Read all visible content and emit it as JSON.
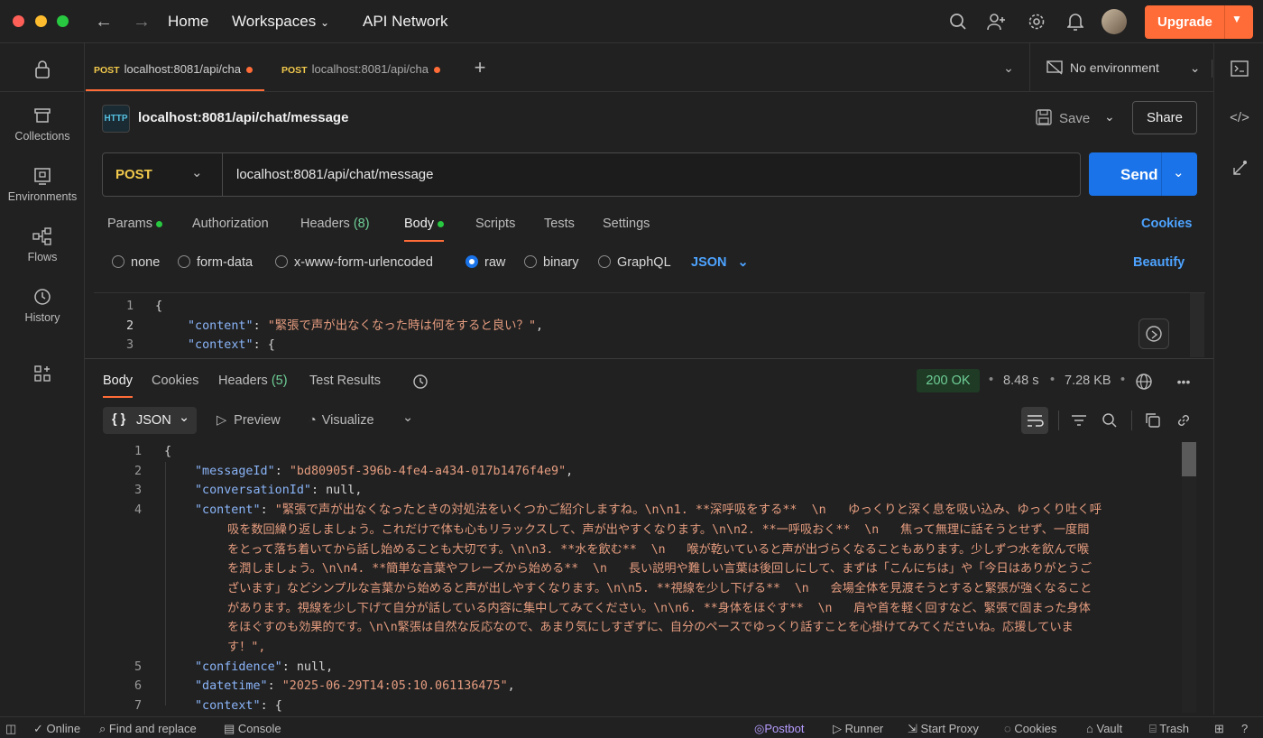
{
  "nav": {
    "home": "Home",
    "workspaces": "Workspaces",
    "api_network": "API Network",
    "upgrade": "Upgrade"
  },
  "sidebar": {
    "items": [
      {
        "label": "Collections",
        "icon": "trash-can-icon"
      },
      {
        "label": "Environments",
        "icon": "environment-icon"
      },
      {
        "label": "Flows",
        "icon": "flows-icon"
      },
      {
        "label": "History",
        "icon": "history-icon"
      }
    ]
  },
  "tabs": [
    {
      "method": "POST",
      "label": "localhost:8081/api/cha"
    },
    {
      "method": "POST",
      "label": "localhost:8081/api/cha"
    }
  ],
  "environment": "No environment",
  "request": {
    "title": "localhost:8081/api/chat/message",
    "save": "Save",
    "share": "Share",
    "method": "POST",
    "url": "localhost:8081/api/chat/message",
    "send": "Send",
    "tabs": {
      "params": "Params",
      "authorization": "Authorization",
      "headers": "Headers",
      "headers_count": "(8)",
      "body": "Body",
      "scripts": "Scripts",
      "tests": "Tests",
      "settings": "Settings"
    },
    "cookies": "Cookies",
    "body_types": {
      "none": "none",
      "form_data": "form-data",
      "urlencoded": "x-www-form-urlencoded",
      "raw": "raw",
      "binary": "binary",
      "graphql": "GraphQL"
    },
    "format": "JSON",
    "beautify": "Beautify",
    "code_lines": [
      {
        "n": "1",
        "text": "{"
      },
      {
        "n": "2",
        "key": "\"content\"",
        "val": "\"緊張で声が出なくなった時は何をすると良い？\"",
        "tail": ","
      },
      {
        "n": "3",
        "key": "\"context\"",
        "val": "{",
        "tail": ""
      }
    ]
  },
  "response": {
    "tabs": {
      "body": "Body",
      "cookies": "Cookies",
      "headers": "Headers",
      "headers_count": "(5)",
      "test_results": "Test Results"
    },
    "status": "200 OK",
    "time": "8.48 s",
    "size": "7.28 KB",
    "format": "JSON",
    "preview": "Preview",
    "visualize": "Visualize",
    "lines": {
      "l1": "{",
      "l2k": "\"messageId\"",
      "l2v": "\"bd80905f-396b-4fe4-a434-017b1476f4e9\"",
      "l3k": "\"conversationId\"",
      "l3v": "null",
      "l4k": "\"content\"",
      "l4v": [
        "\"緊張で声が出なくなったときの対処法をいくつかご紹介しますね。\\n\\n1. **深呼吸をする**  \\n   ゆっくりと深く息を吸い込み、ゆっくり吐く呼",
        "吸を数回繰り返しましょう。これだけで体も心もリラックスして、声が出やすくなります。\\n\\n2. **一呼吸おく**  \\n   焦って無理に話そうとせず、一度間",
        "をとって落ち着いてから話し始めることも大切です。\\n\\n3. **水を飲む**  \\n   喉が乾いていると声が出づらくなることもあります。少しずつ水を飲んで喉",
        "を潤しましょう。\\n\\n4. **簡単な言葉やフレーズから始める**  \\n   長い説明や難しい言葉は後回しにして、まずは「こんにちは」や「今日はありがとうご",
        "ざいます」などシンプルな言葉から始めると声が出しやすくなります。\\n\\n5. **視線を少し下げる**  \\n   会場全体を見渡そうとすると緊張が強くなること",
        "があります。視線を少し下げて自分が話している内容に集中してみてください。\\n\\n6. **身体をほぐす**  \\n   肩や首を軽く回すなど、緊張で固まった身体",
        "をほぐすのも効果的です。\\n\\n緊張は自然な反応なので、あまり気にしすぎずに、自分のペースでゆっくり話すことを心掛けてみてくださいね。応援していま",
        "す！\","
      ],
      "l5k": "\"confidence\"",
      "l5v": "null",
      "l6k": "\"datetime\"",
      "l6v": "\"2025-06-29T14:05:10.061136475\"",
      "l7k": "\"context\"",
      "l7v": "{"
    }
  },
  "statusbar": {
    "online": "Online",
    "find": "Find and replace",
    "console": "Console",
    "postbot": "Postbot",
    "runner": "Runner",
    "proxy": "Start Proxy",
    "cookies": "Cookies",
    "vault": "Vault",
    "trash": "Trash"
  },
  "colors": {
    "accent": "#ff6c37",
    "send": "#1a73e8",
    "status_ok_bg": "#1f3b25",
    "status_ok_text": "#6fcf97"
  }
}
